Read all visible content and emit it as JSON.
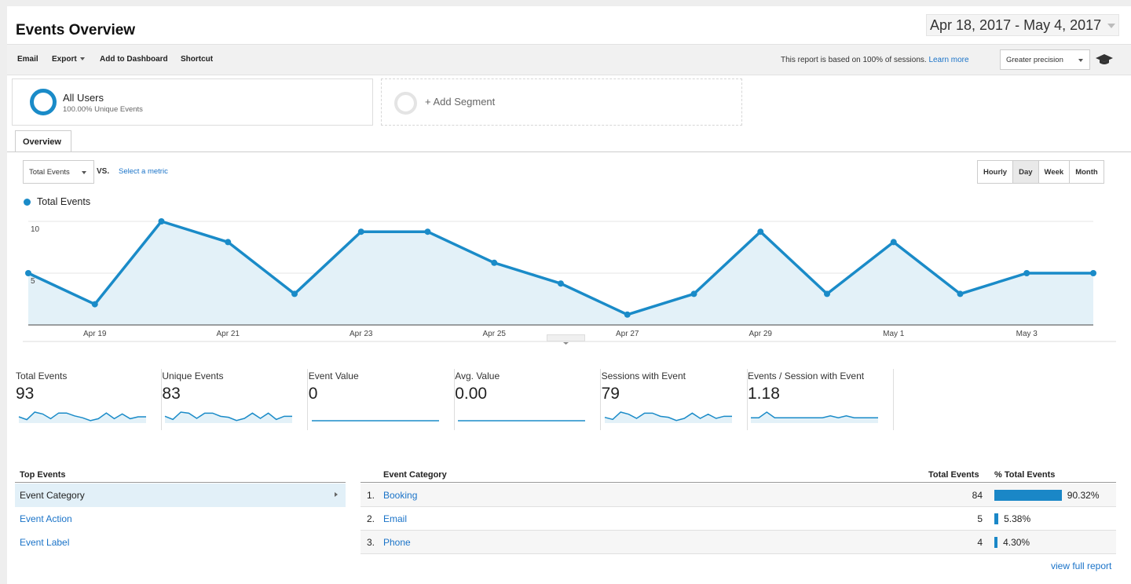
{
  "header": {
    "title": "Events Overview",
    "date_range": "Apr 18, 2017 - May 4, 2017"
  },
  "toolbar": {
    "email": "Email",
    "export": "Export",
    "add_to_dashboard": "Add to Dashboard",
    "shortcut": "Shortcut",
    "sampling_note": "This report is based on 100% of sessions.",
    "learn_more": "Learn more",
    "precision": "Greater precision"
  },
  "segments": {
    "active_name": "All Users",
    "active_sub": "100.00% Unique Events",
    "add_label": "+ Add Segment"
  },
  "tabs": {
    "overview": "Overview"
  },
  "controls": {
    "metric": "Total Events",
    "vs": "VS.",
    "select_metric": "Select a metric",
    "granularity": [
      "Hourly",
      "Day",
      "Week",
      "Month"
    ],
    "active_granularity": "Day"
  },
  "chart_data": {
    "type": "area",
    "series": [
      {
        "name": "Total Events",
        "values": [
          5,
          2,
          10,
          8,
          3,
          9,
          9,
          6,
          4,
          1,
          3,
          9,
          3,
          8,
          3,
          5,
          5
        ]
      }
    ],
    "x": [
      "Apr 18",
      "Apr 19",
      "Apr 20",
      "Apr 21",
      "Apr 22",
      "Apr 23",
      "Apr 24",
      "Apr 25",
      "Apr 26",
      "Apr 27",
      "Apr 28",
      "Apr 29",
      "Apr 30",
      "May 1",
      "May 2",
      "May 3",
      "May 4"
    ],
    "x_tick_labels": [
      "Apr 19",
      "Apr 21",
      "Apr 23",
      "Apr 25",
      "Apr 27",
      "Apr 29",
      "May 1",
      "May 3"
    ],
    "y_tick_labels": [
      "10",
      "5"
    ],
    "ylim": [
      0,
      10
    ],
    "grid": true,
    "color": "#1a8bc8",
    "fill": "#e3f1f8"
  },
  "scorecards": [
    {
      "label": "Total Events",
      "value": "93",
      "spark": [
        5,
        2,
        10,
        8,
        3,
        9,
        9,
        6,
        4,
        1,
        3,
        9,
        3,
        8,
        3,
        5,
        5
      ]
    },
    {
      "label": "Unique Events",
      "value": "83",
      "spark": [
        5,
        2,
        9,
        8,
        3,
        8,
        8,
        5,
        4,
        1,
        3,
        8,
        3,
        8,
        2,
        5,
        5
      ]
    },
    {
      "label": "Event Value",
      "value": "0",
      "spark": [
        0,
        0,
        0,
        0,
        0,
        0,
        0,
        0,
        0,
        0,
        0,
        0,
        0,
        0,
        0,
        0,
        0
      ]
    },
    {
      "label": "Avg. Value",
      "value": "0.00",
      "spark": [
        0,
        0,
        0,
        0,
        0,
        0,
        0,
        0,
        0,
        0,
        0,
        0,
        0,
        0,
        0,
        0,
        0
      ]
    },
    {
      "label": "Sessions with Event",
      "value": "79",
      "spark": [
        4,
        2,
        9,
        7,
        3,
        8,
        8,
        5,
        4,
        1,
        3,
        8,
        3,
        7,
        3,
        5,
        5
      ]
    },
    {
      "label": "Events / Session with Event",
      "value": "1.18",
      "spark": [
        2,
        2,
        5,
        2,
        2,
        2,
        2,
        2,
        2,
        2,
        3,
        2,
        3,
        2,
        2,
        2,
        2
      ]
    }
  ],
  "top_events": {
    "heading": "Top Events",
    "items": [
      "Event Category",
      "Event Action",
      "Event Label"
    ]
  },
  "event_table": {
    "headers": {
      "category": "Event Category",
      "total": "Total Events",
      "pct": "% Total Events"
    },
    "rows": [
      {
        "idx": "1.",
        "name": "Booking",
        "total": "84",
        "pct": "90.32%",
        "share": 0.9032
      },
      {
        "idx": "2.",
        "name": "Email",
        "total": "5",
        "pct": "5.38%",
        "share": 0.0538
      },
      {
        "idx": "3.",
        "name": "Phone",
        "total": "4",
        "pct": "4.30%",
        "share": 0.043
      }
    ],
    "view_full": "view full report"
  }
}
